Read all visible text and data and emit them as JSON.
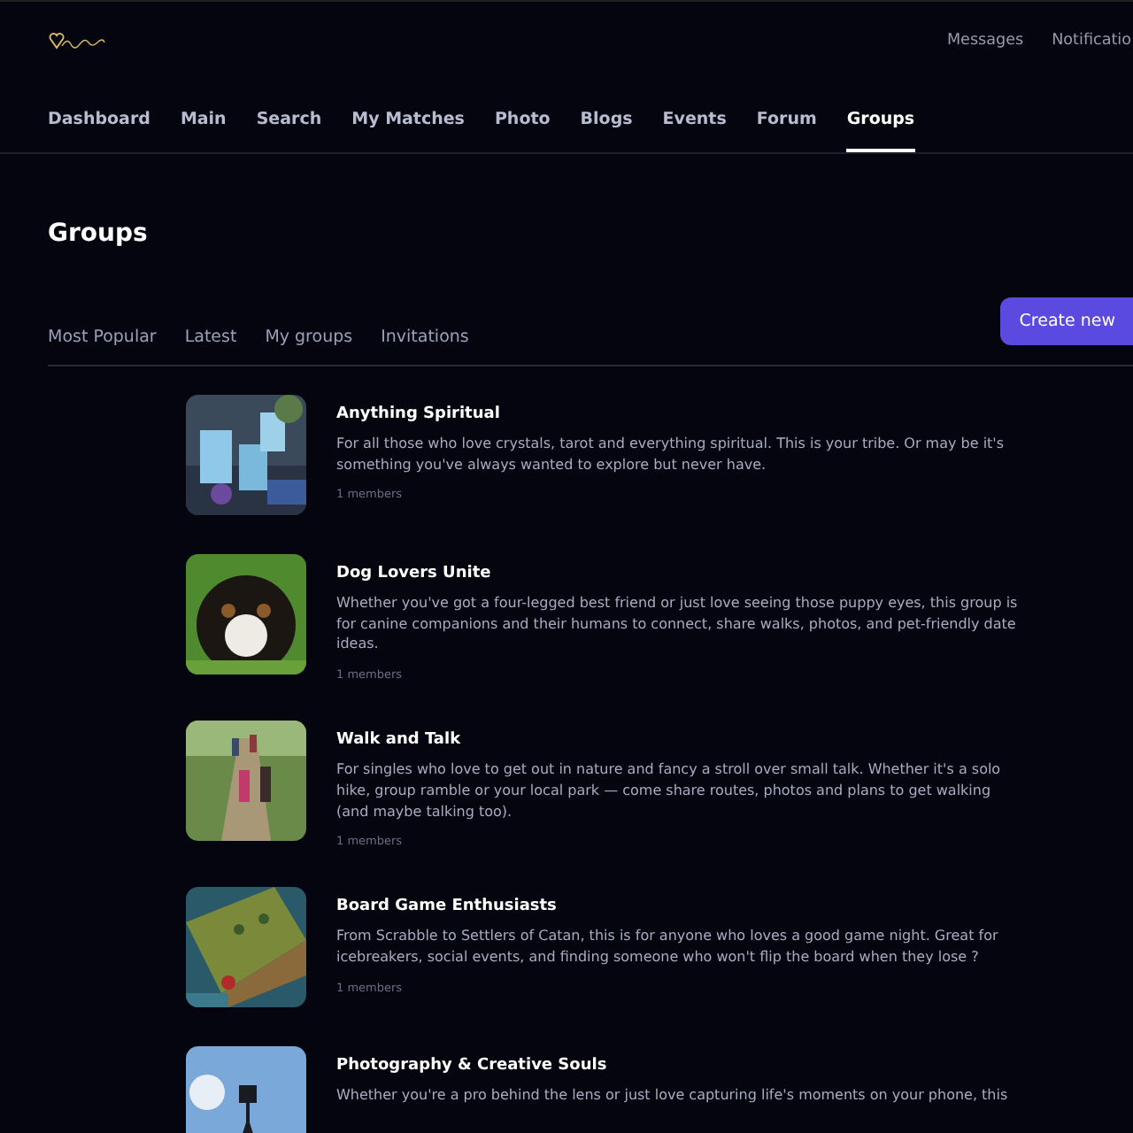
{
  "header": {
    "links": [
      {
        "label": "Messages"
      },
      {
        "label": "Notificatio"
      }
    ]
  },
  "nav": [
    {
      "label": "Dashboard",
      "selected": false
    },
    {
      "label": "Main",
      "selected": false
    },
    {
      "label": "Search",
      "selected": false
    },
    {
      "label": "My Matches",
      "selected": false
    },
    {
      "label": "Photo",
      "selected": false
    },
    {
      "label": "Blogs",
      "selected": false
    },
    {
      "label": "Events",
      "selected": false
    },
    {
      "label": "Forum",
      "selected": false
    },
    {
      "label": "Groups",
      "selected": true
    }
  ],
  "page_title": "Groups",
  "filters": [
    {
      "label": "Most Popular"
    },
    {
      "label": "Latest"
    },
    {
      "label": "My groups"
    },
    {
      "label": "Invitations"
    }
  ],
  "create_button": "Create new",
  "groups": [
    {
      "title": "Anything Spiritual",
      "description": "For all those who love crystals, tarot and everything spiritual.  This is your tribe.  Or may be it's something you've always wanted to explore but never have.",
      "members": "1 members"
    },
    {
      "title": "Dog Lovers Unite",
      "description": "Whether you've got a four-legged best friend or just love seeing those puppy eyes, this group is for canine companions and their humans to connect, share walks, photos, and pet-friendly date ideas.",
      "members": "1 members"
    },
    {
      "title": "Walk and Talk",
      "description": "For singles who love to get out in nature and fancy a stroll over small talk. Whether it's a solo hike, group ramble or your local park — come share routes, photos and plans to get walking (and maybe talking too).",
      "members": "1 members"
    },
    {
      "title": "Board Game Enthusiasts",
      "description": "From Scrabble to Settlers of Catan, this is for anyone who loves a good game night. Great for icebreakers, social events, and finding someone who won't flip the board when they lose ?",
      "members": "1 members"
    },
    {
      "title": "Photography & Creative Souls",
      "description": "Whether you're a pro behind the lens or just love capturing life's moments on your phone, this"
    }
  ]
}
